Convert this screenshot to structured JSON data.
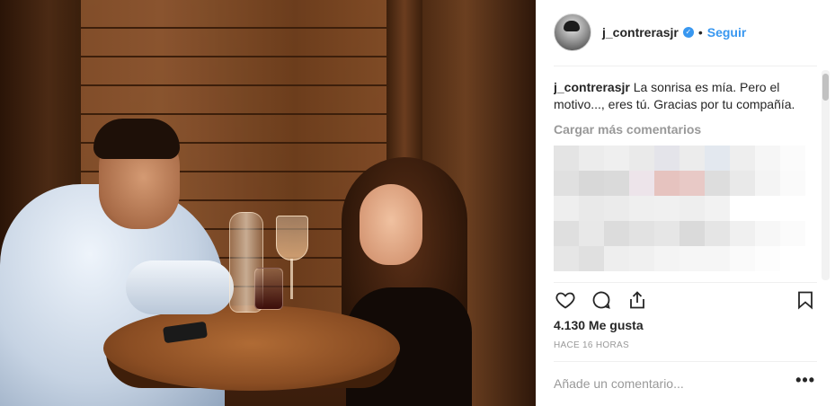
{
  "post": {
    "header": {
      "username": "j_contrerasjr",
      "separator": "•",
      "follow_label": "Seguir",
      "verified_icon": "verified-badge-icon"
    },
    "caption": {
      "username": "j_contrerasjr",
      "text": "La sonrisa es mía. Pero el motivo..., eres tú. Gracias por tu compañía."
    },
    "load_more_label": "Cargar más comentarios",
    "actions": {
      "like_icon": "heart-icon",
      "comment_icon": "comment-icon",
      "share_icon": "share-icon",
      "save_icon": "bookmark-icon"
    },
    "likes_text": "4.130 Me gusta",
    "timestamp": "HACE 16 HORAS",
    "comment_input": {
      "placeholder": "Añade un comentario..."
    },
    "more_label": "•••"
  },
  "colors": {
    "accent": "#3897f0",
    "muted": "#999999",
    "text": "#262626",
    "border": "#efefef"
  }
}
